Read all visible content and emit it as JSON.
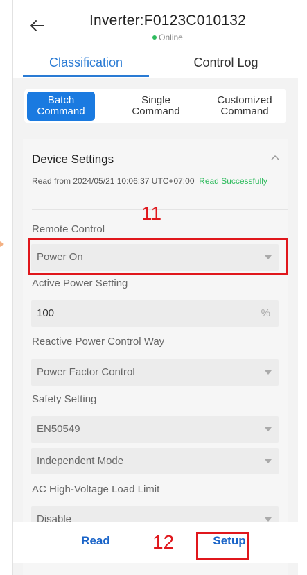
{
  "header": {
    "back_icon": "back-arrow-icon",
    "title": "Inverter:F0123C010132",
    "status": "Online",
    "status_color": "#2ebb5d"
  },
  "tabs": [
    {
      "label": "Classification",
      "active": true
    },
    {
      "label": "Control Log",
      "active": false
    }
  ],
  "segmented": [
    {
      "label": "Batch\nCommand",
      "active": true
    },
    {
      "label": "Single\nCommand",
      "active": false
    },
    {
      "label": "Customized\nCommand",
      "active": false
    }
  ],
  "device_settings": {
    "title": "Device Settings",
    "read_info": "Read from 2024/05/21 10:06:37 UTC+07:00",
    "read_status": "Read Successfully",
    "collapse_icon": "chevron-up-icon",
    "fields": {
      "remote_control": {
        "label": "Remote Control",
        "value": "Power On"
      },
      "active_power": {
        "label": "Active Power Setting",
        "value": "100",
        "unit": "%"
      },
      "reactive_power": {
        "label": "Reactive Power Control Way",
        "value": "Power Factor Control"
      },
      "safety_setting": {
        "label": "Safety Setting",
        "value": "EN50549"
      },
      "mode": {
        "value": "Independent Mode"
      },
      "ac_high_voltage": {
        "label": "AC High-Voltage Load Limit",
        "value": "Disable"
      }
    }
  },
  "actions": {
    "read_label": "Read",
    "setup_label": "Setup"
  },
  "annotations": {
    "step_11": "11",
    "step_12": "12",
    "highlight_color": "#e0171c"
  },
  "colors": {
    "accent": "#1a7ae0",
    "link": "#1a64c8"
  }
}
